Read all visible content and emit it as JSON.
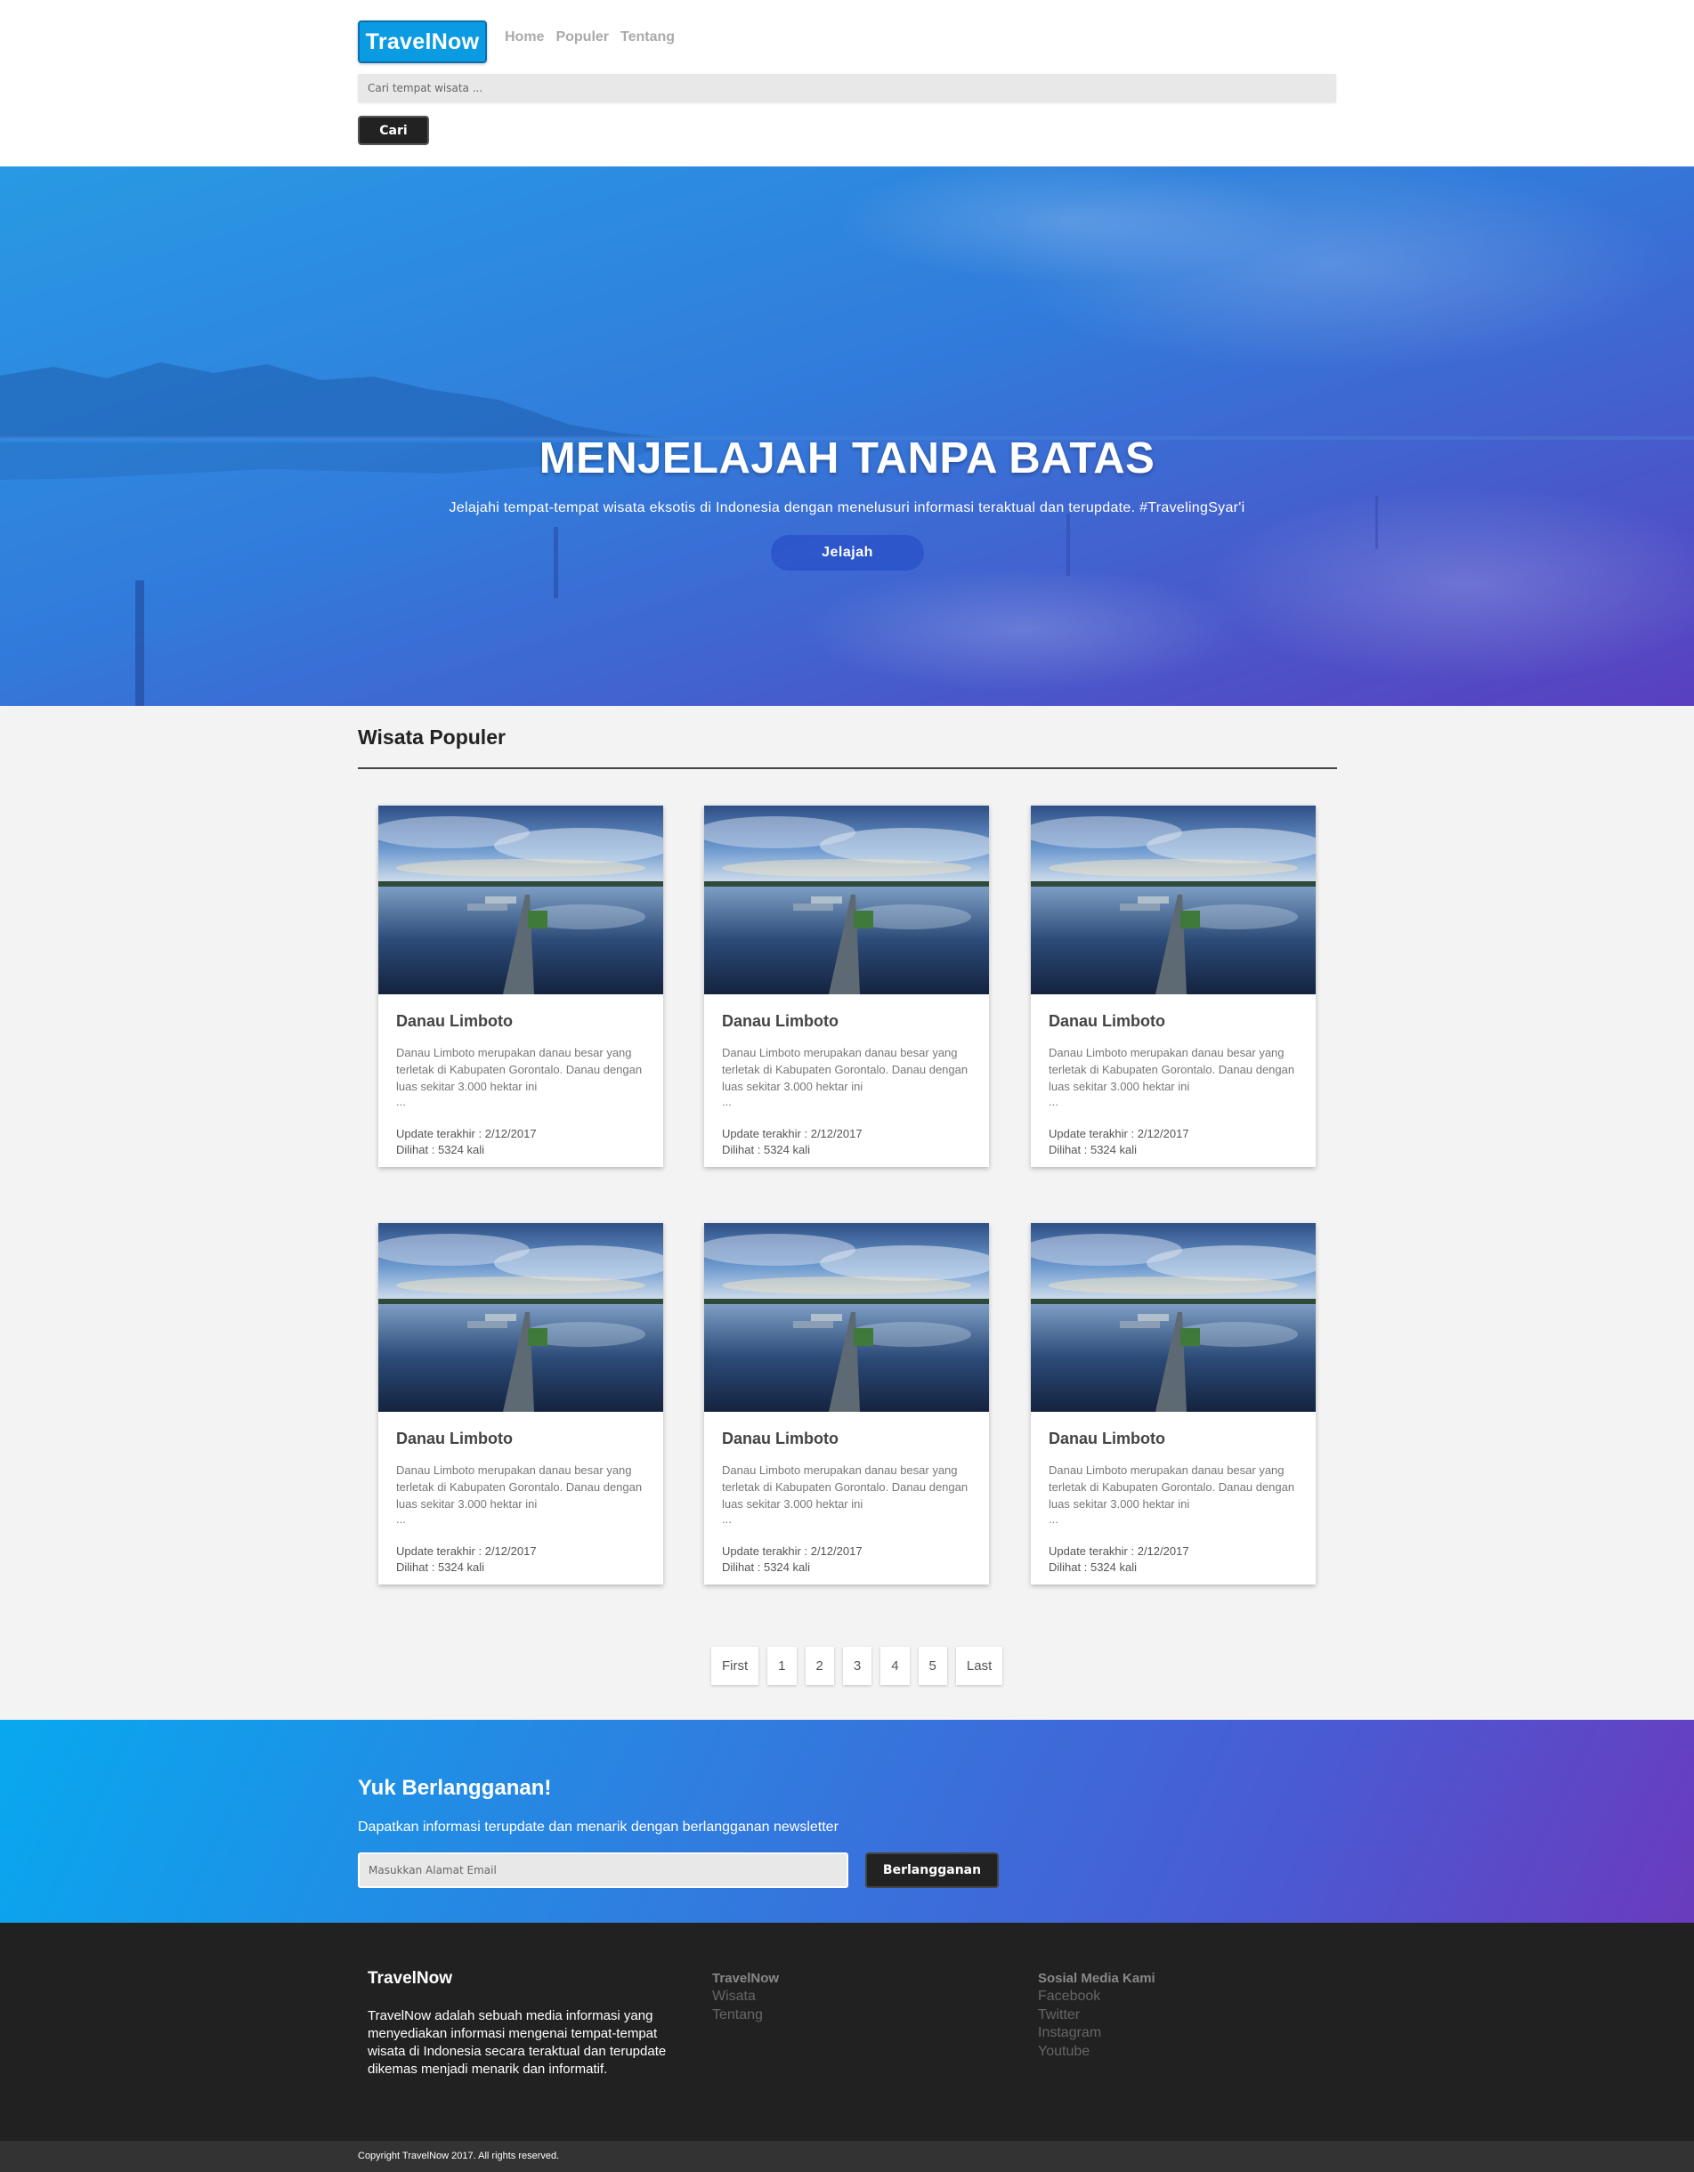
{
  "header": {
    "brand": "TravelNow",
    "nav": [
      "Home",
      "Populer",
      "Tentang"
    ],
    "search_placeholder": "Cari tempat wisata ...",
    "search_button": "Cari"
  },
  "hero": {
    "title": "MENJELAJAH TANPA BATAS",
    "subtitle": "Jelajahi tempat-tempat wisata eksotis di Indonesia dengan menelusuri informasi teraktual dan terupdate. #TravelingSyar'i",
    "button": "Jelajah"
  },
  "popular": {
    "title": "Wisata Populer",
    "cards": [
      {
        "title": "Danau Limboto",
        "description": "Danau Limboto merupakan danau besar yang terletak di Kabupaten Gorontalo. Danau dengan luas sekitar 3.000 hektar ini",
        "ellipsis": "...",
        "updated": "Update terakhir : 2/12/2017",
        "views": "Dilihat : 5324 kali"
      },
      {
        "title": "Danau Limboto",
        "description": "Danau Limboto merupakan danau besar yang terletak di Kabupaten Gorontalo. Danau dengan luas sekitar 3.000 hektar ini",
        "ellipsis": "...",
        "updated": "Update terakhir : 2/12/2017",
        "views": "Dilihat : 5324 kali"
      },
      {
        "title": "Danau Limboto",
        "description": "Danau Limboto merupakan danau besar yang terletak di Kabupaten Gorontalo. Danau dengan luas sekitar 3.000 hektar ini",
        "ellipsis": "...",
        "updated": "Update terakhir : 2/12/2017",
        "views": "Dilihat : 5324 kali"
      },
      {
        "title": "Danau Limboto",
        "description": "Danau Limboto merupakan danau besar yang terletak di Kabupaten Gorontalo. Danau dengan luas sekitar 3.000 hektar ini",
        "ellipsis": "...",
        "updated": "Update terakhir : 2/12/2017",
        "views": "Dilihat : 5324 kali"
      },
      {
        "title": "Danau Limboto",
        "description": "Danau Limboto merupakan danau besar yang terletak di Kabupaten Gorontalo. Danau dengan luas sekitar 3.000 hektar ini",
        "ellipsis": "...",
        "updated": "Update terakhir : 2/12/2017",
        "views": "Dilihat : 5324 kali"
      },
      {
        "title": "Danau Limboto",
        "description": "Danau Limboto merupakan danau besar yang terletak di Kabupaten Gorontalo. Danau dengan luas sekitar 3.000 hektar ini",
        "ellipsis": "...",
        "updated": "Update terakhir : 2/12/2017",
        "views": "Dilihat : 5324 kali"
      }
    ],
    "pagination": [
      "First",
      "1",
      "2",
      "3",
      "4",
      "5",
      "Last"
    ]
  },
  "newsletter": {
    "title": "Yuk Berlangganan!",
    "subtitle": "Dapatkan informasi terupdate dan menarik dengan berlangganan newsletter",
    "email_placeholder": "Masukkan Alamat Email",
    "button": "Berlangganan"
  },
  "footer": {
    "brand": "TravelNow",
    "about": "TravelNow adalah sebuah media informasi yang menyediakan informasi mengenai tempat-tempat wisata di Indonesia secara teraktual dan terupdate dikemas menjadi menarik dan informatif.",
    "links_heading": "TravelNow",
    "links": [
      "Wisata",
      "Tentang"
    ],
    "social_heading": "Sosial Media Kami",
    "social": [
      "Facebook",
      "Twitter",
      "Instagram",
      "Youtube"
    ],
    "copyright": "Copyright TravelNow 2017. All rights reserved."
  },
  "colors": {
    "brand": "#0a9be3",
    "hero_start": "#2aa0e6",
    "hero_end": "#5a3fbf",
    "dark": "#212121"
  }
}
